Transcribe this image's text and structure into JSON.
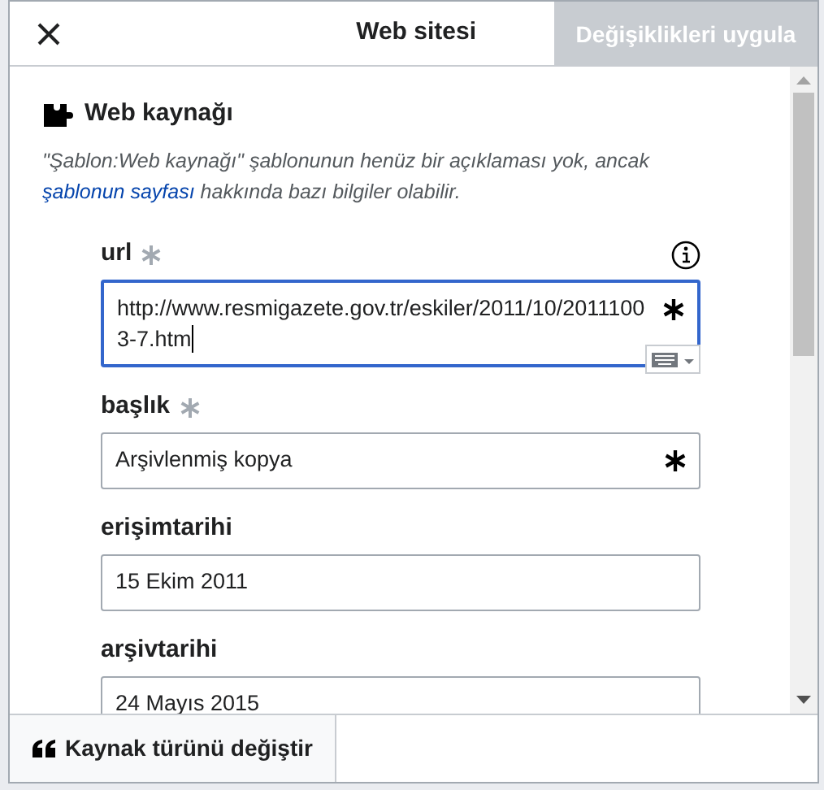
{
  "dialog": {
    "title": "Web sitesi",
    "apply_button": {
      "label": "Değişiklikleri uygula",
      "disabled": true
    }
  },
  "template": {
    "name": "Web kaynağı",
    "description_before": "\"Şablon:Web kaynağı\" şablonunun henüz bir açıklaması yok, ancak",
    "link": "şablonun sayfası",
    "description_after": "hakkında bazı bilgiler olabilir."
  },
  "fields": [
    {
      "label": "url",
      "required": true,
      "info": true,
      "focused": true,
      "value": "http://www.resmigazete.gov.tr/eskiler/2011/10/20111003-7.htm"
    },
    {
      "label": "başlık",
      "required": true,
      "info": false,
      "focused": false,
      "value": "Arşivlenmiş kopya"
    },
    {
      "label": "erişimtarihi",
      "required": false,
      "info": false,
      "focused": false,
      "value": "15 Ekim 2011"
    },
    {
      "label": "arşivtarihi",
      "required": false,
      "info": false,
      "focused": false,
      "value": "24 Mayıs 2015"
    }
  ],
  "footer": {
    "change_type_button": "Kaynak türünü değiştir"
  }
}
